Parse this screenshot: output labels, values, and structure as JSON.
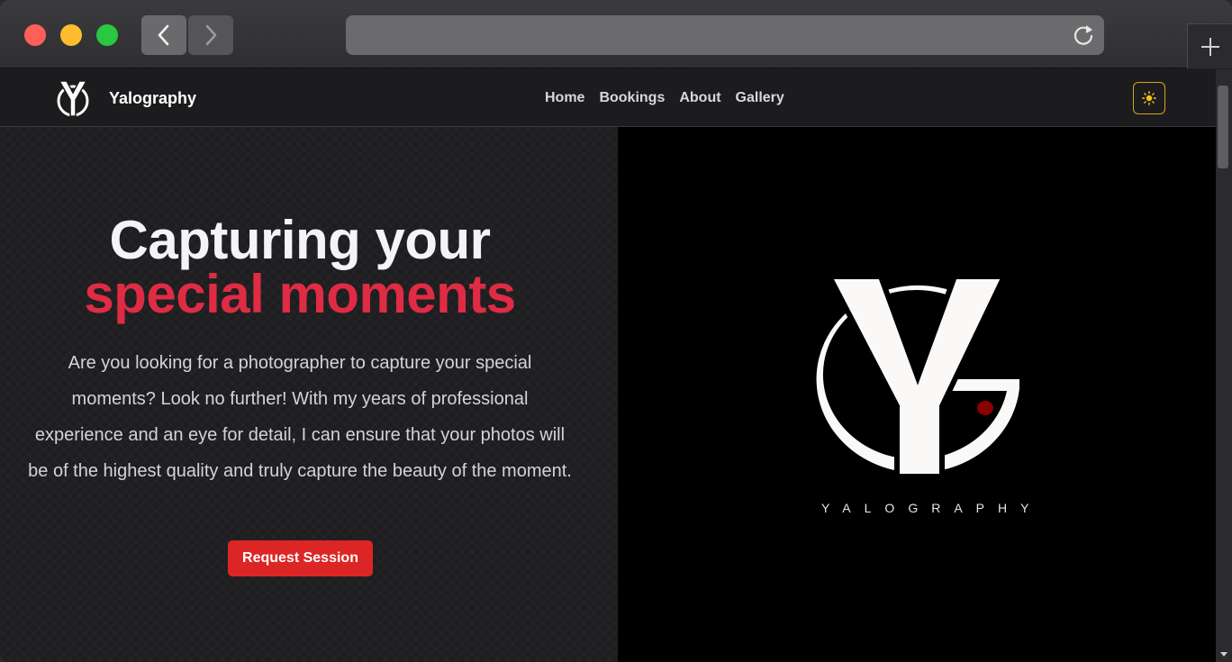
{
  "browser": {
    "back_icon": "chevron-left-icon",
    "forward_icon": "chevron-right-icon",
    "reload_icon": "reload-icon",
    "new_tab_icon": "plus-icon",
    "url": ""
  },
  "nav": {
    "brand": "Yalography",
    "links": [
      "Home",
      "Bookings",
      "About",
      "Gallery"
    ],
    "theme_icon": "sun-icon"
  },
  "hero": {
    "title_line1": "Capturing your",
    "title_line2": "special moments",
    "description": "Are you looking for a photographer to capture your special moments? Look no further! With my years of professional experience and an eye for detail, I can ensure that your photos will be of the highest quality and truly capture the beauty of the moment.",
    "cta_label": "Request Session"
  },
  "logo": {
    "wordmark": "YALOGRAPHY"
  },
  "colors": {
    "accent": "#e02b44",
    "button": "#dc2626",
    "theme_border": "#d4a21a"
  }
}
